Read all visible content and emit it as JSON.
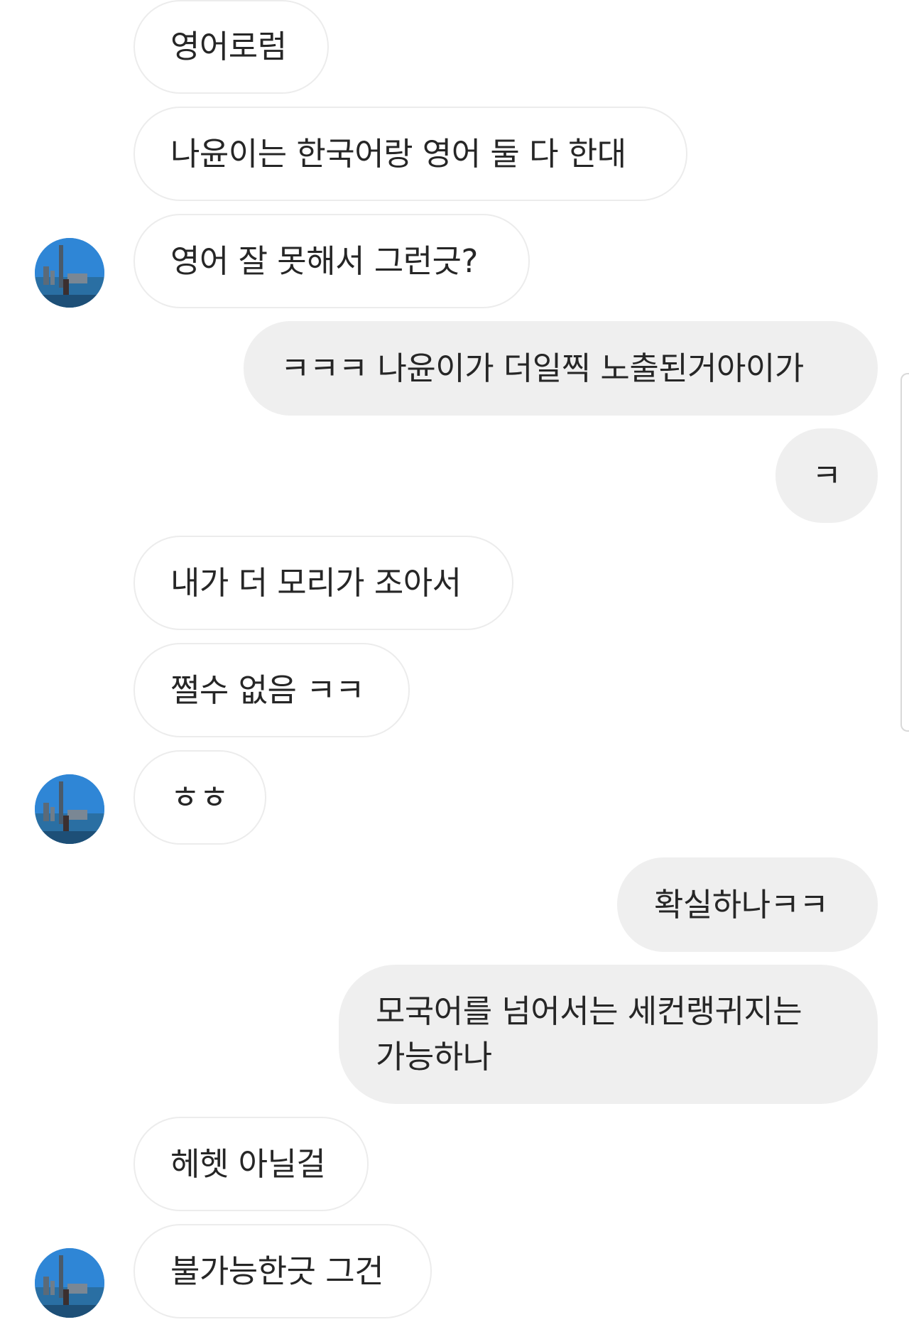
{
  "messages": [
    {
      "sender": "other",
      "text": "영어로럼"
    },
    {
      "sender": "other",
      "text": "나윤이는 한국어랑 영어 둘 다 한대"
    },
    {
      "sender": "other",
      "text": "영어 잘 못해서 그런긋?"
    },
    {
      "sender": "me",
      "text": "ㅋㅋㅋ 나윤이가 더일찍 노출된거아이가"
    },
    {
      "sender": "me",
      "text": "ㅋ"
    },
    {
      "sender": "other",
      "text": "내가 더 모리가 조아서"
    },
    {
      "sender": "other",
      "text": "쩔수 없음 ㅋㅋ"
    },
    {
      "sender": "other",
      "text": "ㅎㅎ"
    },
    {
      "sender": "me",
      "text": "확실하나ㅋㅋ"
    },
    {
      "sender": "me",
      "text": "모국어를 넘어서는 세컨랭귀지는 가능하나"
    },
    {
      "sender": "other",
      "text": "헤헷 아닐걸"
    },
    {
      "sender": "other",
      "text": "불가능한긋 그건"
    }
  ],
  "avatar": {
    "icon": "profile-photo-avatar",
    "colors": {
      "sky": "#2f86d6",
      "water": "#2a6fa3",
      "tower": "#4a5a6a"
    }
  },
  "colors": {
    "incoming_bubble_bg": "#ffffff",
    "incoming_bubble_border": "#ececec",
    "outgoing_bubble_bg": "#efefef",
    "text": "#262626"
  }
}
